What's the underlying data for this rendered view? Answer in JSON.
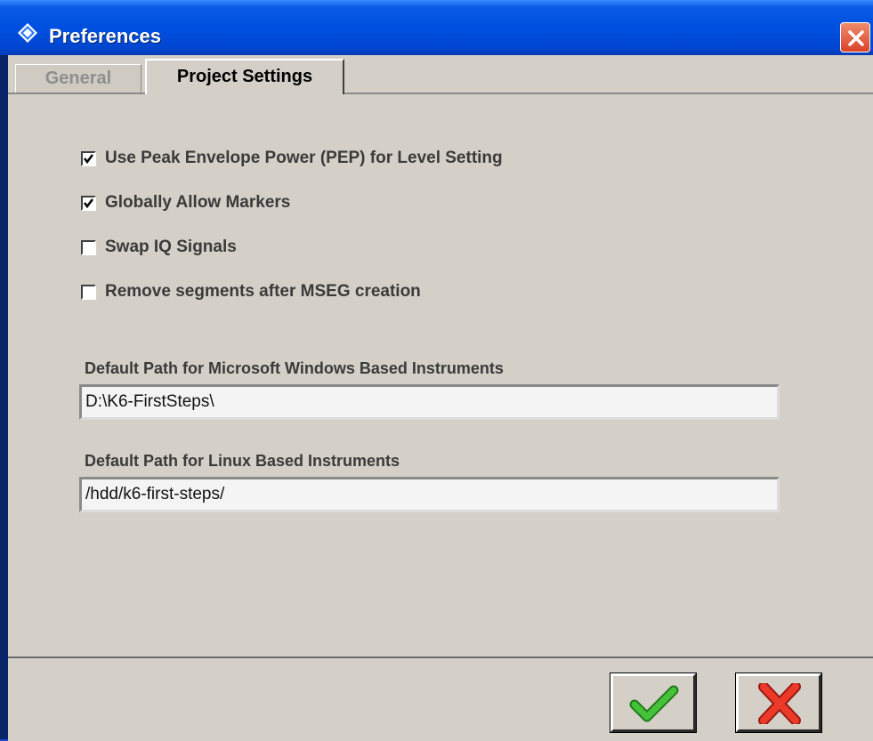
{
  "window": {
    "title": "Preferences",
    "icon": "rohde-schwarz-logo-icon",
    "close_icon": "close-icon"
  },
  "tabs": [
    {
      "label": "General",
      "active": false
    },
    {
      "label": "Project Settings",
      "active": true
    }
  ],
  "options": [
    {
      "label": "Use Peak Envelope Power (PEP) for Level Setting",
      "checked": true
    },
    {
      "label": "Globally Allow Markers",
      "checked": true
    },
    {
      "label": "Swap IQ Signals",
      "checked": false
    },
    {
      "label": "Remove segments after MSEG creation",
      "checked": false
    }
  ],
  "paths": {
    "windows_label": "Default Path for Microsoft Windows Based Instruments",
    "windows_value": "D:\\K6-FirstSteps\\",
    "linux_label": "Default Path for Linux Based Instruments",
    "linux_value": "/hdd/k6-first-steps/"
  },
  "buttons": {
    "ok_icon": "green-checkmark-icon",
    "cancel_icon": "red-x-icon"
  },
  "colors": {
    "titlebar": "#0054e3",
    "dialog_bg": "#d4d0c8",
    "close_button": "#d8432a",
    "ok_check": "#2fa82a",
    "cancel_x": "#e02a1e"
  }
}
